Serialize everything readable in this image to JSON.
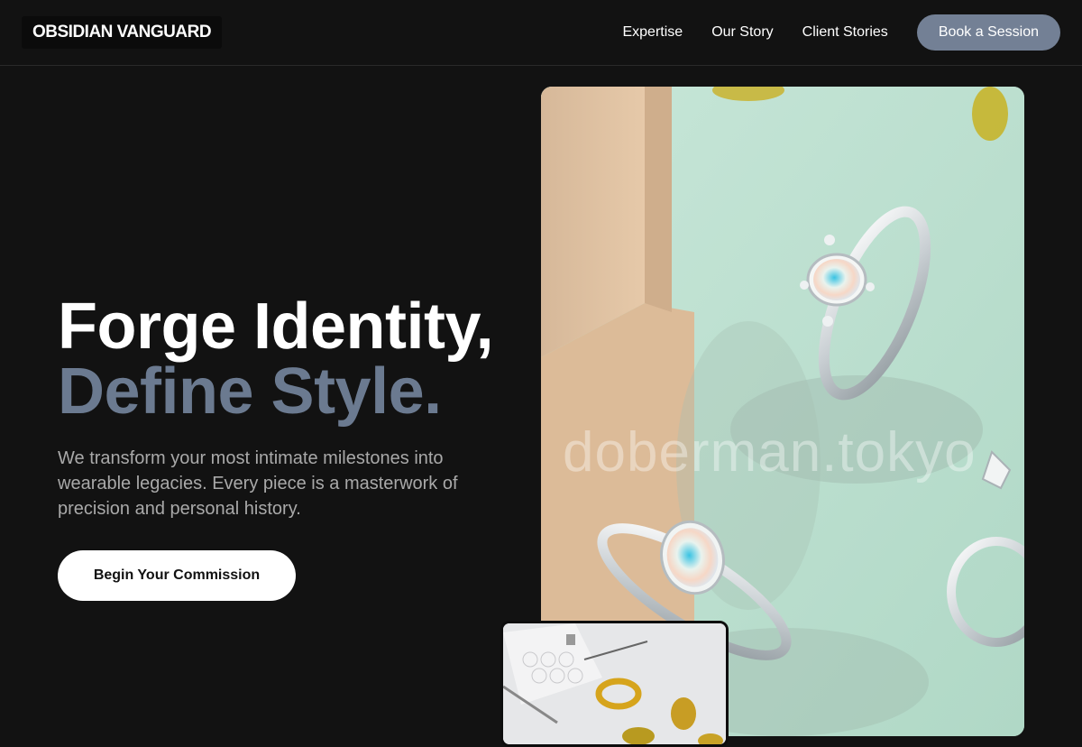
{
  "header": {
    "logo": "OBSIDIAN VANGUARD",
    "nav": [
      {
        "label": "Expertise"
      },
      {
        "label": "Our Story"
      },
      {
        "label": "Client Stories"
      }
    ],
    "cta_label": "Book a Session"
  },
  "hero": {
    "title_line1": "Forge Identity,",
    "title_line2": "Define Style.",
    "description": "We transform your most intimate milestones into wearable legacies. Every piece is a masterwork of precision and personal history.",
    "cta_label": "Begin Your Commission"
  },
  "image": {
    "watermark": "doberman.tokyo"
  },
  "colors": {
    "background": "#121212",
    "accent": "#738095",
    "title_secondary": "#6b7a90",
    "image_bg": "#b9ddcf"
  }
}
